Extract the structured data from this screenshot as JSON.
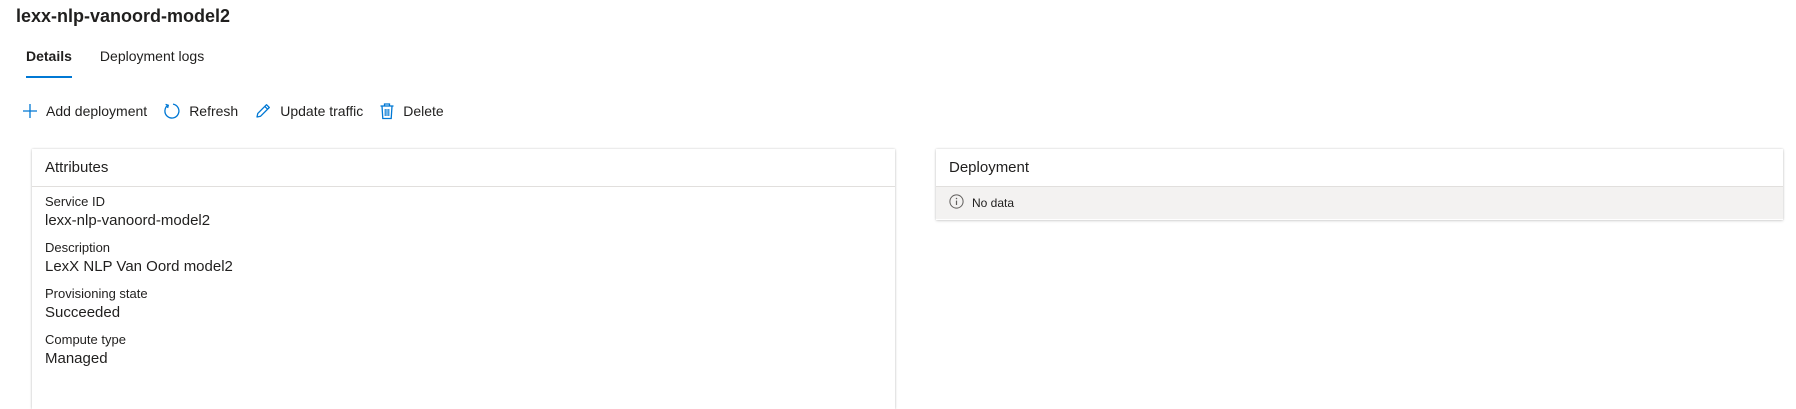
{
  "page": {
    "title": "lexx-nlp-vanoord-model2"
  },
  "tabs": [
    {
      "label": "Details",
      "active": true
    },
    {
      "label": "Deployment logs",
      "active": false
    }
  ],
  "toolbar": {
    "add_deployment": {
      "label": "Add deployment",
      "icon": "plus-icon"
    },
    "refresh": {
      "label": "Refresh",
      "icon": "refresh-icon"
    },
    "update_traffic": {
      "label": "Update traffic",
      "icon": "pencil-icon"
    },
    "delete": {
      "label": "Delete",
      "icon": "trash-icon"
    }
  },
  "attributes": {
    "header": "Attributes",
    "items": [
      {
        "label": "Service ID",
        "value": "lexx-nlp-vanoord-model2"
      },
      {
        "label": "Description",
        "value": "LexX NLP Van Oord model2"
      },
      {
        "label": "Provisioning state",
        "value": "Succeeded"
      },
      {
        "label": "Compute type",
        "value": "Managed"
      }
    ]
  },
  "deployment": {
    "header": "Deployment",
    "empty_message": "No data",
    "empty_icon": "info-icon"
  },
  "colors": {
    "accent": "#0078d4",
    "text": "#201f1e",
    "muted_bg": "#f3f2f1"
  }
}
